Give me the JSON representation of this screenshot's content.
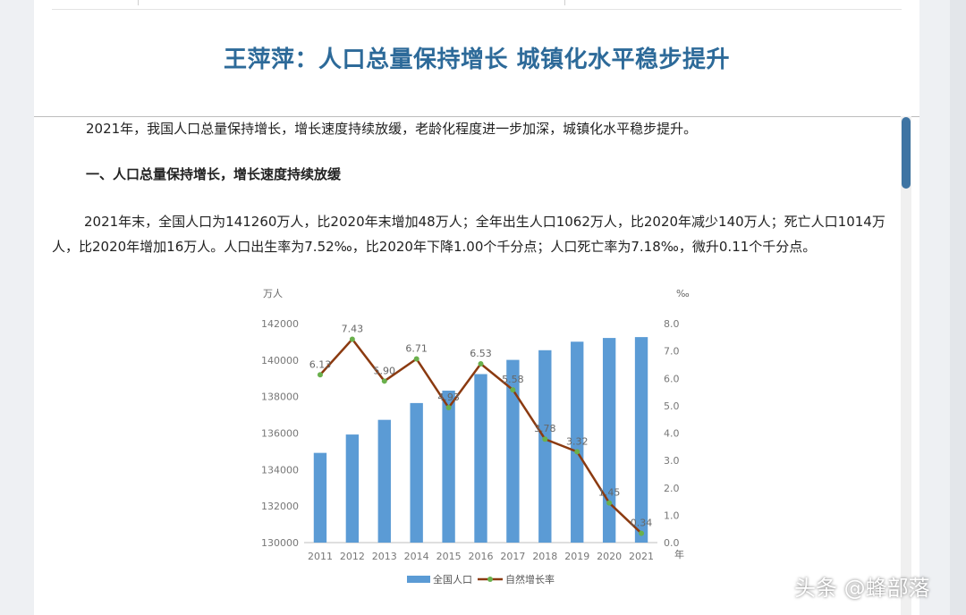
{
  "article": {
    "title": "王萍萍：人口总量保持增长 城镇化水平稳步提升",
    "intro": "2021年，我国人口总量保持增长，增长速度持续放缓，老龄化程度进一步加深，城镇化水平稳步提升。",
    "section_heading": "一、人口总量保持增长，增长速度持续放缓",
    "body": "2021年末，全国人口为141260万人，比2020年末增加48万人；全年出生人口1062万人，比2020年减少140万人；死亡人口1014万人，比2020年增加16万人。人口出生率为7.52‰，比2020年下降1.00个千分点；人口死亡率为7.18‰，微升0.11个千分点。"
  },
  "watermark": "头条 @蜂部落",
  "colors": {
    "title": "#2d6a99",
    "bar": "#5b9bd5",
    "line": "#8b3a10",
    "marker": "#6ab04c",
    "scroll_thumb": "#3e74a3"
  },
  "chart_data": {
    "type": "bar",
    "categories": [
      "2011",
      "2012",
      "2013",
      "2014",
      "2015",
      "2016",
      "2017",
      "2018",
      "2019",
      "2020",
      "2021"
    ],
    "xlabel": "年",
    "ylabel": "万人",
    "y2label": "‰",
    "ylim": [
      130000,
      142000
    ],
    "y_ticks": [
      "130000",
      "132000",
      "134000",
      "136000",
      "138000",
      "140000",
      "142000"
    ],
    "y2lim": [
      0,
      8
    ],
    "y2_ticks": [
      "0.0",
      "1.0",
      "2.0",
      "3.0",
      "4.0",
      "5.0",
      "6.0",
      "7.0",
      "8.0"
    ],
    "series": [
      {
        "name": "全国人口",
        "type": "bar",
        "axis": "left",
        "values": [
          134916,
          135922,
          136726,
          137646,
          138326,
          139232,
          140011,
          140541,
          141008,
          141212,
          141260
        ]
      },
      {
        "name": "自然增长率",
        "type": "line",
        "axis": "right",
        "values": [
          6.13,
          7.43,
          5.9,
          6.71,
          4.93,
          6.53,
          5.58,
          3.78,
          3.32,
          1.45,
          0.34
        ],
        "labels": [
          "6.13",
          "7.43",
          "5.90",
          "6.71",
          "4.93",
          "6.53",
          "5.58",
          "3.78",
          "3.32",
          "1.45",
          "0.34"
        ]
      }
    ],
    "legend_position": "bottom",
    "grid": false
  }
}
